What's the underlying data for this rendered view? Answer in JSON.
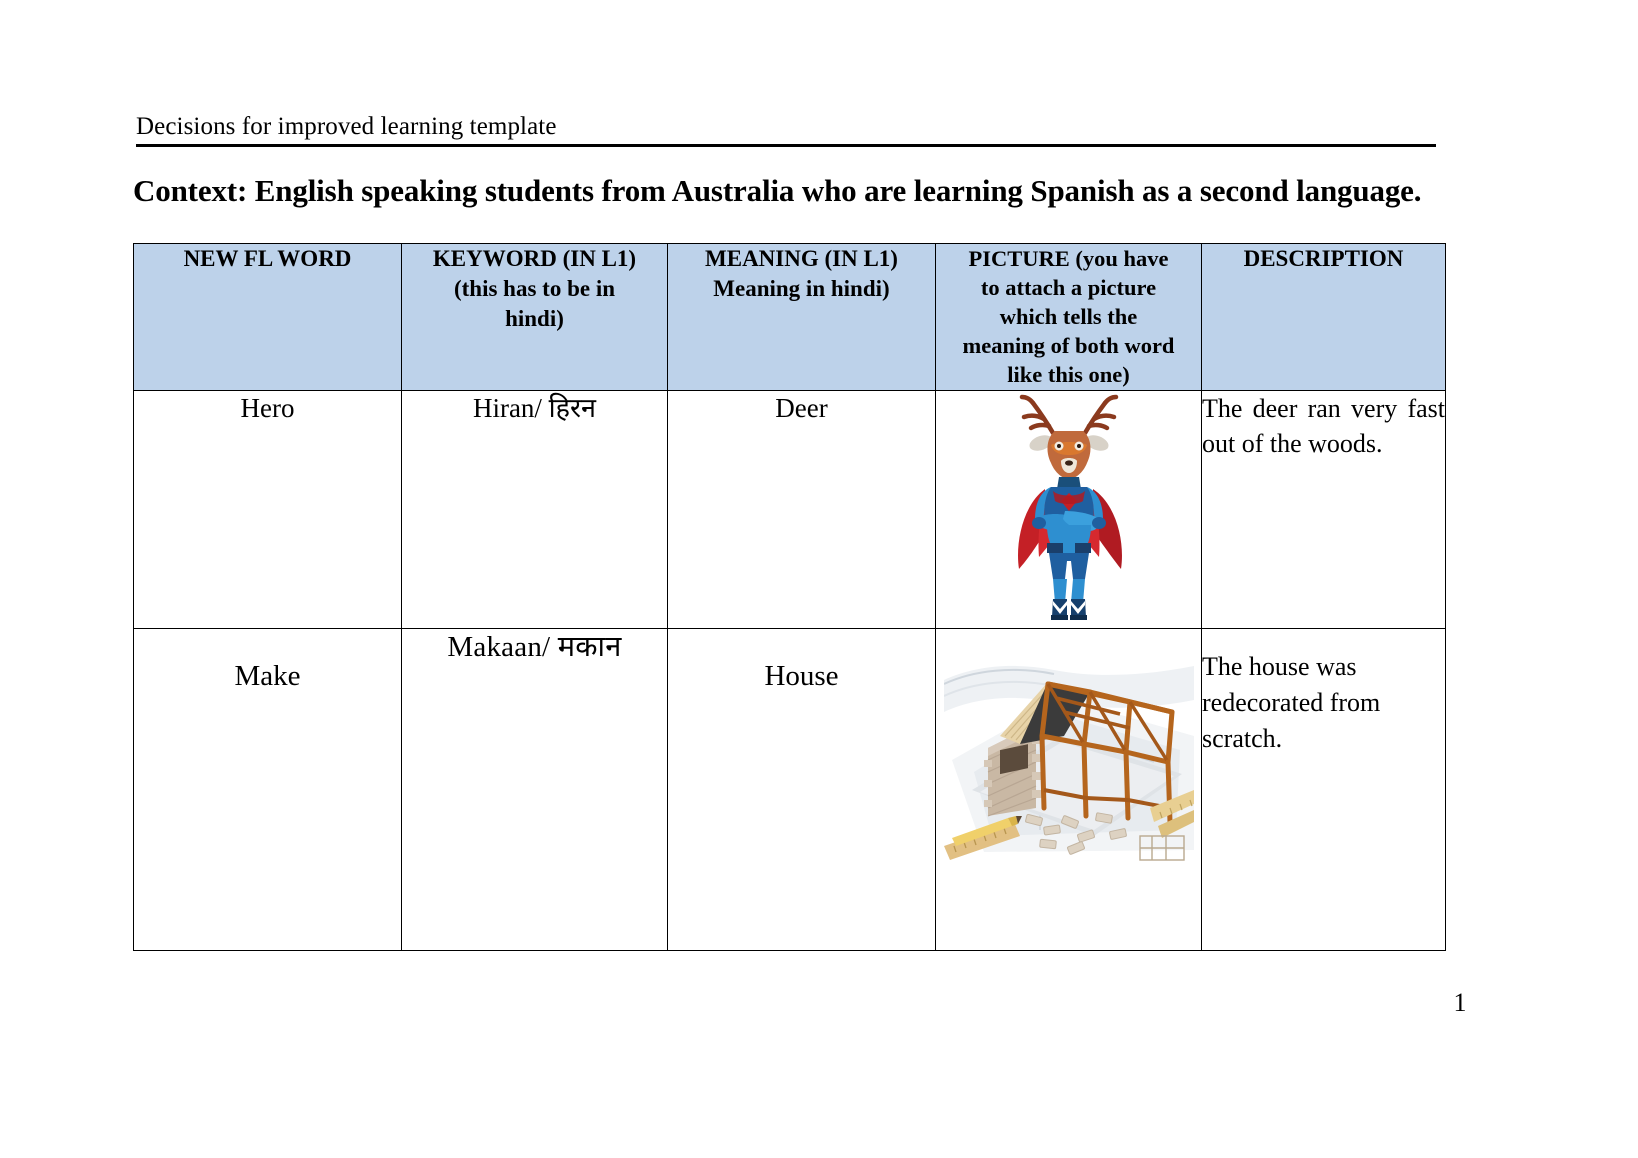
{
  "document": {
    "header_text": "Decisions for improved learning template",
    "context_title": "Context: English speaking students from Australia who are learning Spanish as a second language.",
    "page_number": "1"
  },
  "table": {
    "headers": [
      "NEW FL WORD",
      "KEYWORD (IN L1) (this has to be in hindi)",
      "MEANING (IN L1) Meaning in hindi)",
      "PICTURE (you have to attach a picture which tells the meaning of both word like this one)",
      "DESCRIPTION"
    ],
    "header_lines": {
      "col1": [
        "NEW FL WORD"
      ],
      "col2": [
        "KEYWORD (IN L1)",
        "(this has to be in",
        "hindi)"
      ],
      "col3": [
        "MEANING (IN L1)",
        "Meaning in hindi)"
      ],
      "col4": [
        "PICTURE (you have",
        "to attach a picture",
        "which tells the",
        "meaning of both word",
        "like this one)"
      ],
      "col5": [
        "DESCRIPTION"
      ]
    },
    "rows": [
      {
        "new_fl_word": "Hero",
        "keyword": "Hiran/ हिरन",
        "meaning": "Deer",
        "picture_alt": "deer-superhero-illustration",
        "description": "The deer ran very fast out of the woods."
      },
      {
        "new_fl_word": "Make",
        "keyword": "Makaan/ मकान",
        "meaning": "House",
        "picture_alt": "house-under-construction-photo",
        "description": "The house was redecorated from scratch."
      }
    ]
  },
  "colors": {
    "header_fill": "#bdd2ea",
    "border": "#000000",
    "text": "#000000",
    "cape_red": "#c42026",
    "suit_blue": "#2e8fd0",
    "antler_brown": "#8b3a1e",
    "wood_brown": "#b5651d",
    "brick_tan": "#c9b8a4"
  }
}
